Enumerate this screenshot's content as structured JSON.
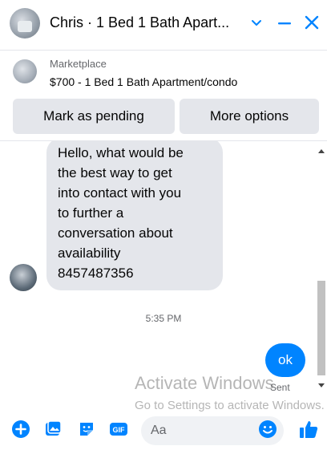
{
  "header": {
    "title": "Chris · 1 Bed 1 Bath Apart...",
    "accent": "#0084ff"
  },
  "listing": {
    "source": "Marketplace",
    "description": "$700 - 1 Bed 1 Bath Apartment/condo"
  },
  "actions": {
    "pending_label": "Mark as pending",
    "more_label": "More options"
  },
  "thread": {
    "incoming_lines": [
      "Hello, what would be",
      "the best way to get",
      "into contact with you",
      "to further a",
      "conversation about",
      "availability",
      "8457487356"
    ],
    "timestamp": "5:35 PM",
    "outgoing": "ok",
    "status": "Sent"
  },
  "watermark": {
    "line1": "Activate Windows",
    "line2": "Go to Settings to activate Windows."
  },
  "composer": {
    "placeholder": "Aa",
    "icons": [
      "plus-icon",
      "photo-icon",
      "sticker-icon",
      "gif-icon",
      "emoji-icon",
      "like-icon"
    ]
  }
}
